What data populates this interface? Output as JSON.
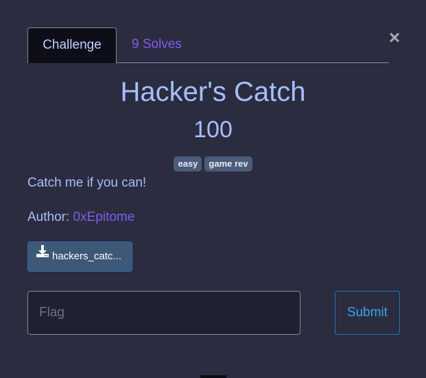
{
  "tabs": {
    "challenge": "Challenge",
    "solves": "9 Solves"
  },
  "close_glyph": "×",
  "challenge": {
    "name": "Hacker's Catch",
    "value": "100",
    "tags": [
      "easy",
      "game rev"
    ],
    "description": "Catch me if you can!",
    "author_label": "Author: ",
    "author_name": "0xEpitome",
    "file_name": "hackers_catc..."
  },
  "flag": {
    "placeholder": "Flag",
    "value": ""
  },
  "submit_label": "Submit",
  "icons": {
    "close": "close-icon",
    "download": "download-icon"
  },
  "colors": {
    "background": "#2b2c3f",
    "accent_purple": "#7e5eea",
    "title_blue": "#a7bfff",
    "submit_blue": "#35a8ee",
    "tag_bg": "#4b5b79",
    "file_button_bg": "#3e5878"
  }
}
